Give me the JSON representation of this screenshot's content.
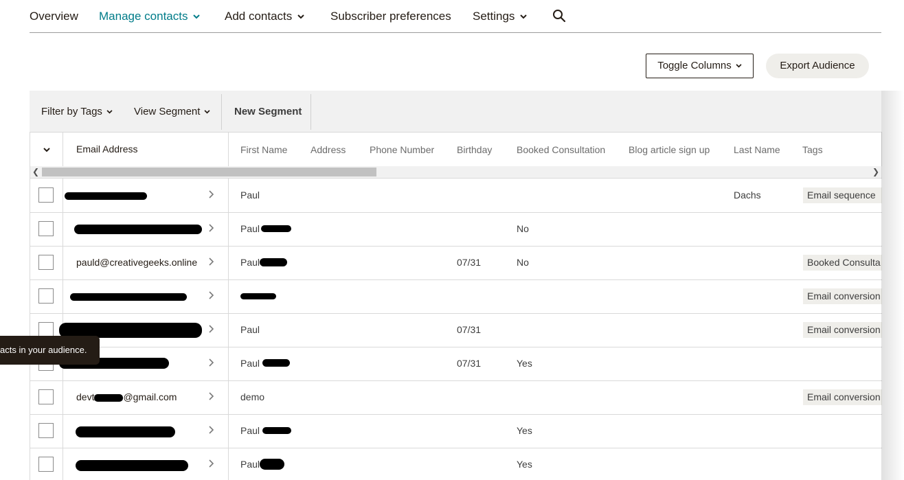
{
  "nav": {
    "items": [
      {
        "label": "Overview",
        "active": false,
        "dropdown": false
      },
      {
        "label": "Manage contacts",
        "active": true,
        "dropdown": true
      },
      {
        "label": "Add contacts",
        "active": false,
        "dropdown": true
      },
      {
        "label": "Subscriber preferences",
        "active": false,
        "dropdown": false
      },
      {
        "label": "Settings",
        "active": false,
        "dropdown": true
      }
    ],
    "search_icon": "search-icon"
  },
  "actions": {
    "toggle_columns": "Toggle Columns",
    "export_audience": "Export Audience"
  },
  "filters": {
    "filter_by_tags": "Filter by Tags",
    "view_segment": "View Segment",
    "new_segment": "New Segment"
  },
  "table": {
    "columns": [
      "Email Address",
      "First Name",
      "Address",
      "Phone Number",
      "Birthday",
      "Booked Consultation",
      "Blog article sign up",
      "Last Name",
      "Tags"
    ],
    "rows": [
      {
        "email": "",
        "first_name": "Paul",
        "birthday": "",
        "booked": "",
        "last_name": "Dachs",
        "tag": "Email sequence"
      },
      {
        "email": "",
        "first_name": "Paul",
        "birthday": "",
        "booked": "No",
        "last_name": "",
        "tag": ""
      },
      {
        "email": "pauld@creativegeeks.online",
        "first_name": "Paul",
        "birthday": "07/31",
        "booked": "No",
        "last_name": "",
        "tag": "Booked Consulta"
      },
      {
        "email": "",
        "first_name": "",
        "birthday": "",
        "booked": "",
        "last_name": "",
        "tag": "Email conversion"
      },
      {
        "email": "",
        "first_name": "Paul",
        "birthday": "07/31",
        "booked": "",
        "last_name": "",
        "tag": "Email conversion"
      },
      {
        "email": "",
        "first_name": "Paul",
        "birthday": "07/31",
        "booked": "Yes",
        "last_name": "",
        "tag": ""
      },
      {
        "email": "devt",
        "email_suffix": "@gmail.com",
        "first_name": "demo",
        "birthday": "",
        "booked": "",
        "last_name": "",
        "tag": "Email conversion"
      },
      {
        "email": "",
        "first_name": "Paul",
        "birthday": "",
        "booked": "Yes",
        "last_name": "",
        "tag": ""
      },
      {
        "email": "",
        "first_name": "Paul",
        "birthday": "",
        "booked": "Yes",
        "last_name": "",
        "tag": ""
      }
    ]
  },
  "tooltip": {
    "text": "acts in your audience."
  },
  "colors": {
    "accent": "#007c89",
    "text": "#241c15",
    "filter_bg": "#f1f1f1",
    "tag_bg": "#efeeea"
  }
}
